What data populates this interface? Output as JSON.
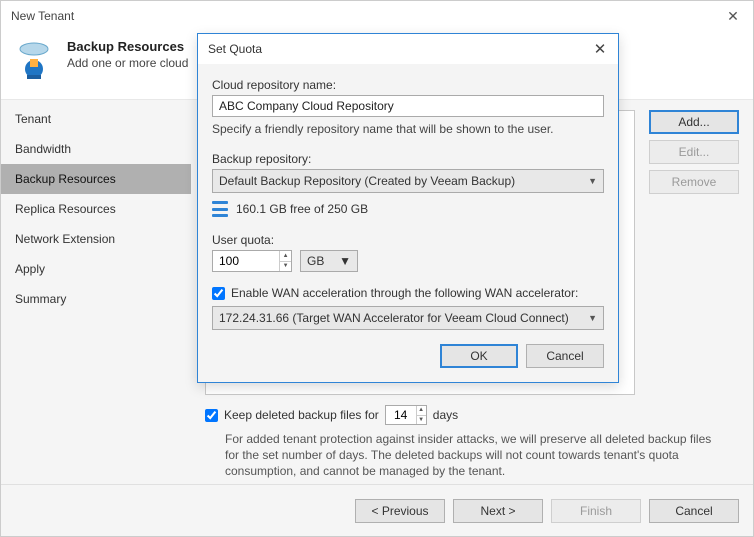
{
  "window": {
    "title": "New Tenant",
    "header_title": "Backup Resources",
    "header_sub": "Add one or more cloud"
  },
  "sidebar": {
    "items": [
      {
        "label": "Tenant"
      },
      {
        "label": "Bandwidth"
      },
      {
        "label": "Backup Resources"
      },
      {
        "label": "Replica Resources"
      },
      {
        "label": "Network Extension"
      },
      {
        "label": "Apply"
      },
      {
        "label": "Summary"
      }
    ]
  },
  "main_buttons": {
    "add": "Add...",
    "edit": "Edit...",
    "remove": "Remove"
  },
  "keep": {
    "label_pre": "Keep deleted backup files for",
    "value": "14",
    "label_post": "days",
    "explain": "For added tenant protection against insider attacks, we will preserve all deleted backup files for the set number of days. The deleted backups will not count towards tenant's quota consumption, and cannot be managed by the tenant."
  },
  "footer": {
    "prev": "< Previous",
    "next": "Next >",
    "finish": "Finish",
    "cancel": "Cancel"
  },
  "modal": {
    "title": "Set Quota",
    "repo_name_label": "Cloud repository name:",
    "repo_name_value": "ABC Company Cloud Repository",
    "repo_name_hint": "Specify a friendly repository name that will be shown to the user.",
    "backup_repo_label": "Backup repository:",
    "backup_repo_value": "Default Backup Repository (Created by Veeam Backup)",
    "storage_free": "160.1 GB free of 250 GB",
    "user_quota_label": "User quota:",
    "user_quota_value": "100",
    "user_quota_unit": "GB",
    "wan_check_label": "Enable WAN acceleration through the following WAN accelerator:",
    "wan_value": "172.24.31.66 (Target WAN Accelerator for Veeam Cloud Connect)",
    "ok": "OK",
    "cancel": "Cancel"
  }
}
